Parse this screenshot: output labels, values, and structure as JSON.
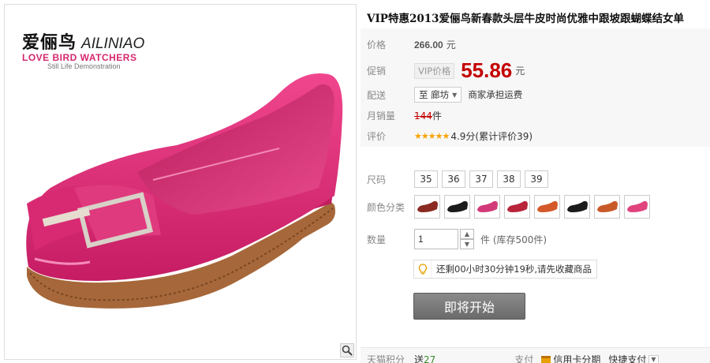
{
  "brand": {
    "name_cn": "爱俪鸟",
    "name_en": "AILINIAO",
    "tagline": "LOVE BIRD WATCHERS",
    "subline": "Still Life Demonstration"
  },
  "product": {
    "title": "VIP特惠2013爱俪鸟新春款头层牛皮时尚优雅中跟坡跟蝴蝶结女单",
    "price_label": "价格",
    "price": "266.00",
    "currency": "元",
    "promo_label": "促销",
    "vip_tag": "VIP价格",
    "promo_price": "55.86",
    "ship_label": "配送",
    "ship_to": "至 廊坊",
    "ship_note": "商家承担运费",
    "sales_label": "月销量",
    "sales_count": "144",
    "sales_unit": "件",
    "rating_label": "评价",
    "stars": "★★★★★",
    "rating_text": "4.9分(累计评价39)"
  },
  "options": {
    "size_label": "尺码",
    "sizes": [
      "35",
      "36",
      "37",
      "38",
      "39"
    ],
    "color_label": "颜色分类",
    "colors": [
      "#8a2a22",
      "#1b1b1b",
      "#d23a7a",
      "#b8243a",
      "#d4582a",
      "#1b1b1b",
      "#c85a2a",
      "#e0437e"
    ],
    "qty_label": "数量",
    "qty_value": "1",
    "stock_text": "件 (库存500件)"
  },
  "notice": {
    "text": "还剩00小时30分钟19秒,请先收藏商品"
  },
  "buy_button": "即将开始",
  "bottom": {
    "points_label": "天猫积分",
    "points_prefix": "送",
    "points_value": "27",
    "pay_label": "支付",
    "credit": "信用卡分期",
    "quick": "快捷支付"
  },
  "colors": {
    "accent": "#c40000",
    "star": "#f5a300",
    "shoe": "#d6266e"
  }
}
